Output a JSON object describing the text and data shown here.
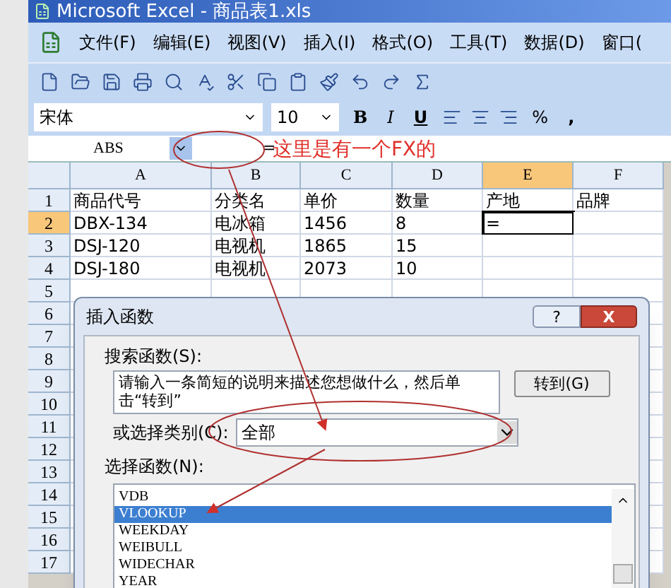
{
  "window": {
    "title": "Microsoft Excel - 商品表1.xls"
  },
  "menu": [
    "文件(F)",
    "编辑(E)",
    "视图(V)",
    "插入(I)",
    "格式(O)",
    "工具(T)",
    "数据(D)",
    "窗口("
  ],
  "format_bar": {
    "font": "宋体",
    "size": "10",
    "bold": "B",
    "italic": "I",
    "underline": "U",
    "percent": "%",
    "comma": ","
  },
  "formula_bar": {
    "name_box": "ABS",
    "formula": "="
  },
  "sheet": {
    "columns": [
      {
        "label": "A",
        "selected": false
      },
      {
        "label": "B",
        "selected": false
      },
      {
        "label": "C",
        "selected": false
      },
      {
        "label": "D",
        "selected": false
      },
      {
        "label": "E",
        "selected": true
      },
      {
        "label": "F",
        "selected": false
      }
    ],
    "rows": [
      {
        "number": "1",
        "selected": false,
        "cells": [
          "商品代号",
          "分类名",
          "单价",
          "数量",
          "产地",
          "品牌"
        ]
      },
      {
        "number": "2",
        "selected": true,
        "cells": [
          "DBX-134",
          "电冰箱",
          "1456",
          "8",
          "=",
          ""
        ]
      },
      {
        "number": "3",
        "selected": false,
        "cells": [
          "DSJ-120",
          "电视机",
          "1865",
          "15",
          "",
          ""
        ]
      },
      {
        "number": "4",
        "selected": false,
        "cells": [
          "DSJ-180",
          "电视机",
          "2073",
          "10",
          "",
          ""
        ]
      },
      {
        "number": "5",
        "selected": false,
        "cells": []
      },
      {
        "number": "6",
        "selected": false,
        "cells": []
      },
      {
        "number": "7",
        "selected": false,
        "cells": []
      },
      {
        "number": "8",
        "selected": false,
        "cells": []
      },
      {
        "number": "9",
        "selected": false,
        "cells": []
      },
      {
        "number": "10",
        "selected": false,
        "cells": []
      },
      {
        "number": "11",
        "selected": false,
        "cells": []
      },
      {
        "number": "12",
        "selected": false,
        "cells": []
      },
      {
        "number": "13",
        "selected": false,
        "cells": []
      },
      {
        "number": "14",
        "selected": false,
        "cells": []
      },
      {
        "number": "15",
        "selected": false,
        "cells": []
      },
      {
        "number": "16",
        "selected": false,
        "cells": []
      },
      {
        "number": "17",
        "selected": false,
        "cells": []
      }
    ]
  },
  "annotation": {
    "text": "这里是有一个FX的"
  },
  "dialog": {
    "title": "插入函数",
    "help": "?",
    "close": "X",
    "search_label": "搜索函数(S):",
    "search_value": "请输入一条简短的说明来描述您想做什么，然后单击“转到”",
    "go_button": "转到(G)",
    "category_label": "或选择类别(C):",
    "category_value": "全部",
    "list_label": "选择函数(N):",
    "functions": [
      {
        "name": "VDB",
        "selected": false
      },
      {
        "name": "VLOOKUP",
        "selected": true
      },
      {
        "name": "WEEKDAY",
        "selected": false
      },
      {
        "name": "WEIBULL",
        "selected": false
      },
      {
        "name": "WIDECHAR",
        "selected": false
      },
      {
        "name": "YEAR",
        "selected": false
      }
    ]
  }
}
